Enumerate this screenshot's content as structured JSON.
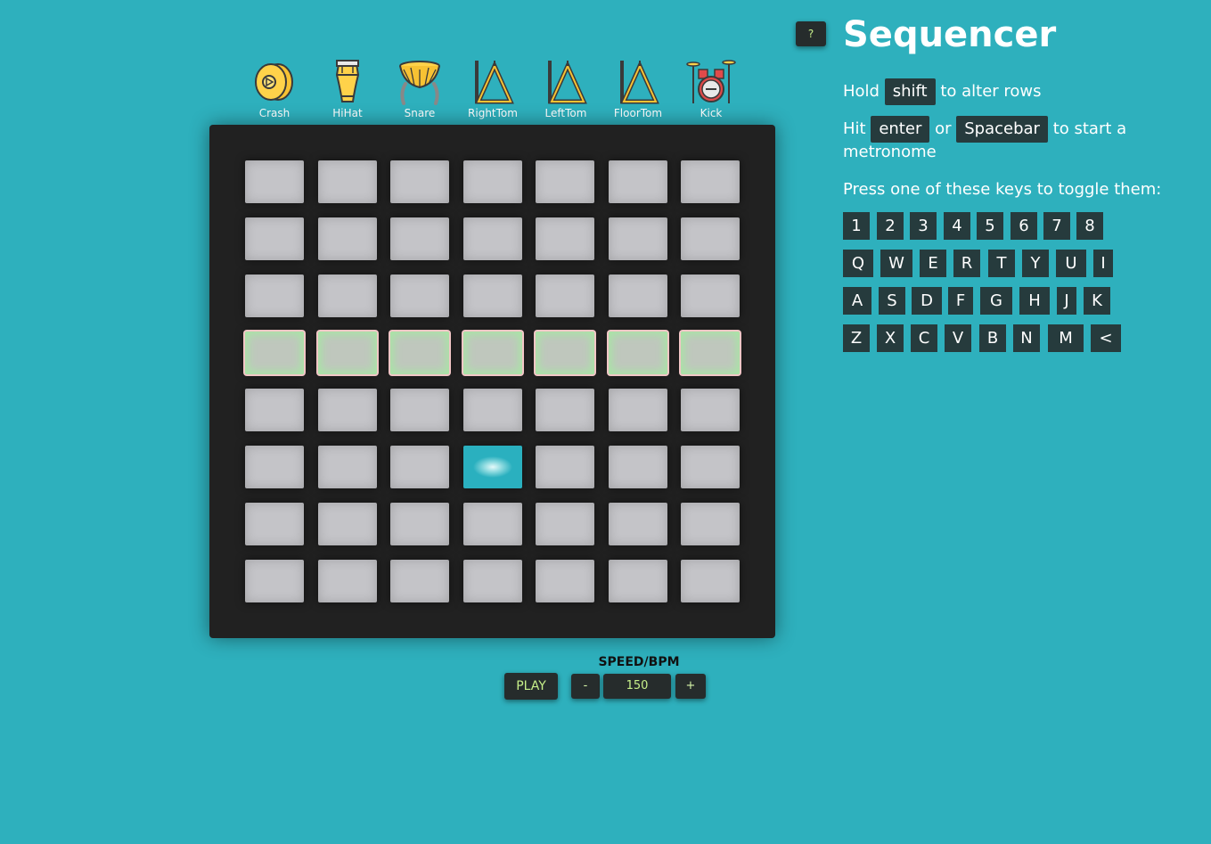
{
  "instruments": [
    {
      "name": "Crash",
      "icon": "crash-cymbal-icon"
    },
    {
      "name": "HiHat",
      "icon": "conga-drum-icon"
    },
    {
      "name": "Snare",
      "icon": "snare-drum-icon"
    },
    {
      "name": "RightTom",
      "icon": "triangle-icon"
    },
    {
      "name": "LeftTom",
      "icon": "triangle-icon"
    },
    {
      "name": "FloorTom",
      "icon": "triangle-icon"
    },
    {
      "name": "Kick",
      "icon": "drum-kit-icon"
    }
  ],
  "grid": {
    "rows": 8,
    "cols": 7,
    "highlighted_row": 3,
    "active_cells": [
      [
        5,
        3
      ]
    ]
  },
  "controls": {
    "play_label": "PLAY",
    "speed_label": "SPEED/BPM",
    "minus_label": "-",
    "plus_label": "+",
    "bpm_value": "150"
  },
  "help_button": "?",
  "sidebar": {
    "title": "Sequencer",
    "hold_prefix": "Hold",
    "hold_key": "shift",
    "hold_suffix": "to alter rows",
    "hit_prefix": "Hit",
    "hit_key1": "enter",
    "hit_or": "or",
    "hit_key2": "Spacebar",
    "hit_suffix": "to start a",
    "hit_suffix2": "metronome",
    "press_text": "Press one of these keys to toggle them:",
    "key_rows": [
      [
        "1",
        "2",
        "3",
        "4",
        "5",
        "6",
        "7",
        "8"
      ],
      [
        "Q",
        "W",
        "E",
        "R",
        "T",
        "Y",
        "U",
        "I"
      ],
      [
        "A",
        "S",
        "D",
        "F",
        "G",
        "H",
        "J",
        "K"
      ],
      [
        "Z",
        "X",
        "C",
        "V",
        "B",
        "N",
        "M",
        "<"
      ]
    ]
  },
  "colors": {
    "background": "#2eb0bd",
    "board": "#212121",
    "pad": "#c4c4c8",
    "pad_active": "#2ab0bf",
    "row_glow": "#a6e8a3",
    "button_bg": "#262c2c",
    "button_text": "#c7f08a",
    "key_bg": "#263b3d"
  }
}
